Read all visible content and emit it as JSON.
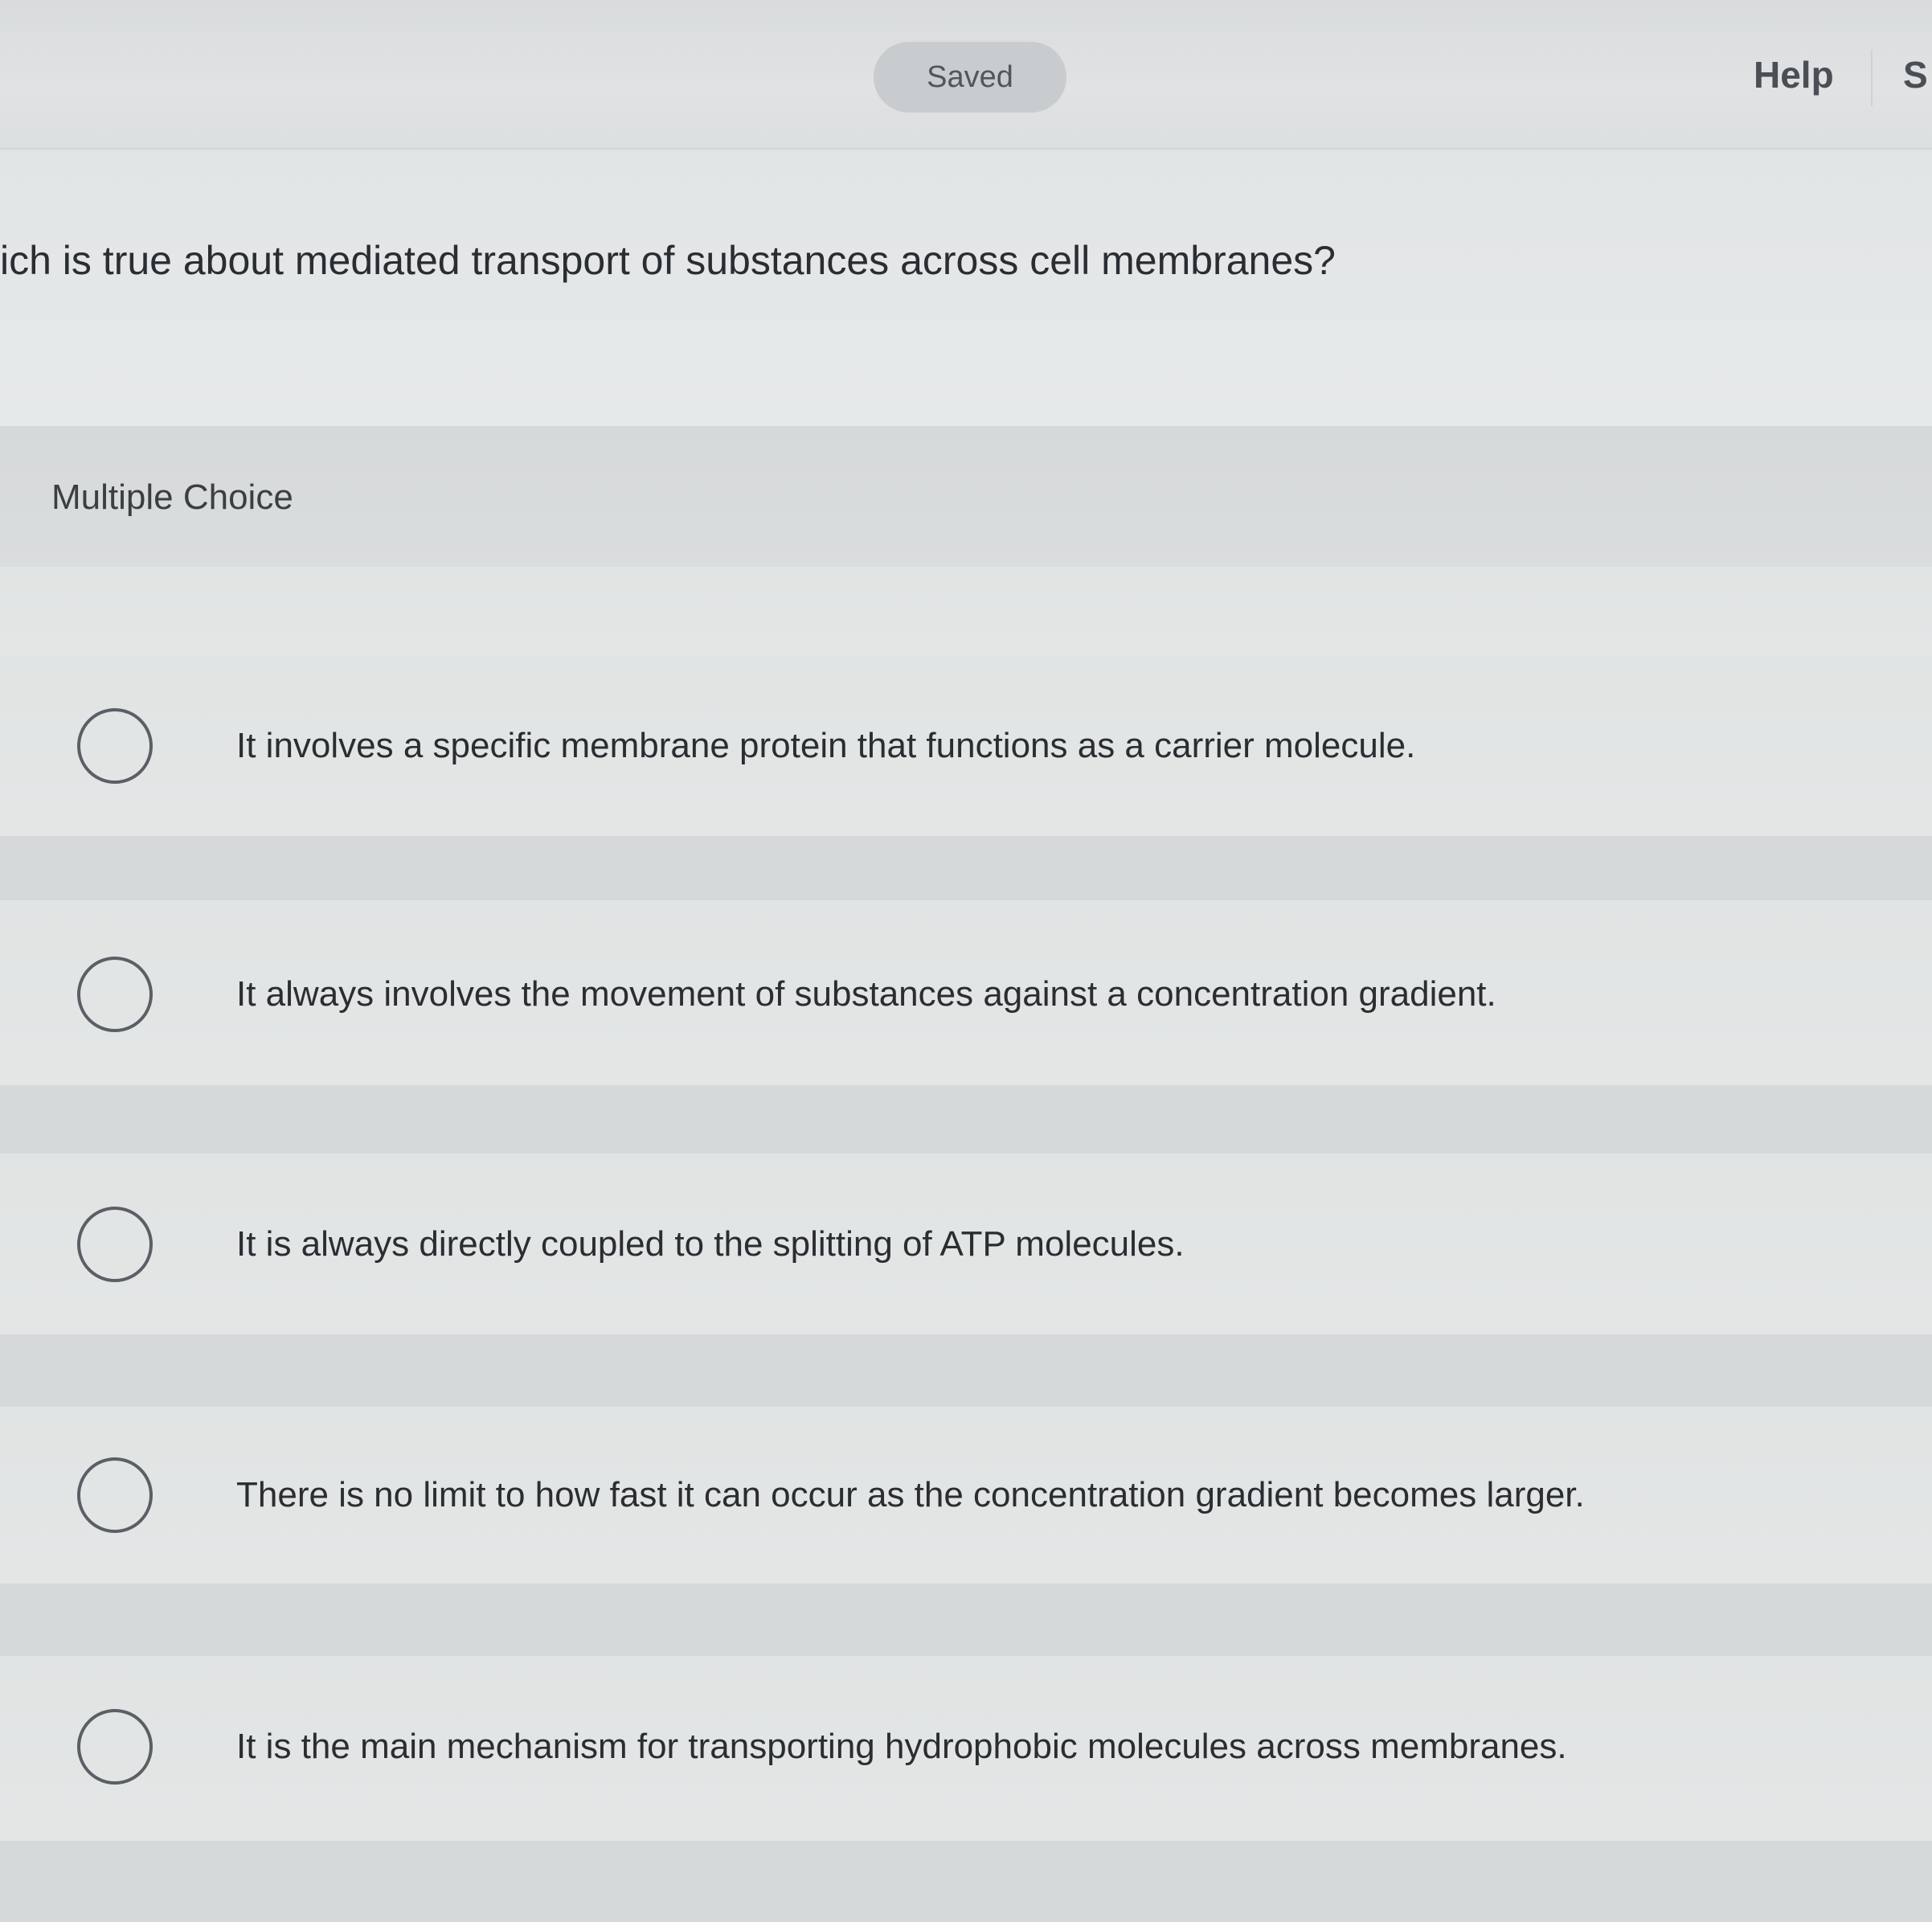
{
  "header": {
    "saved_label": "Saved",
    "help_label": "Help",
    "cut_label": "S"
  },
  "question": {
    "text": "ich is true about mediated transport of substances across cell membranes?"
  },
  "answer_section": {
    "type_label": "Multiple Choice",
    "options": [
      {
        "label": "It involves a specific membrane protein that functions as a carrier molecule."
      },
      {
        "label": "It always involves the movement of substances against a concentration gradient."
      },
      {
        "label": "It is always directly coupled to the splitting of ATP molecules."
      },
      {
        "label": "There is no limit to how fast it can occur as the concentration gradient becomes larger."
      },
      {
        "label": "It is the main mechanism for transporting hydrophobic molecules across membranes."
      }
    ]
  }
}
